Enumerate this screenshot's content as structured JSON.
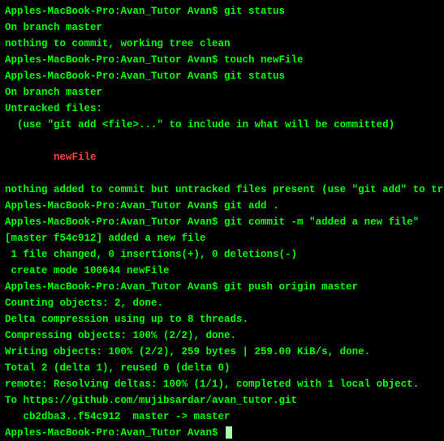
{
  "prompt": "Apples-MacBook-Pro:Avan_Tutor Avan$ ",
  "lines": {
    "l0_cmd": "git status",
    "l1": "On branch master",
    "l2": "nothing to commit, working tree clean",
    "l3_cmd": "touch newFile",
    "l4_cmd": "git status",
    "l5": "On branch master",
    "l6": "Untracked files:",
    "l7": "  (use \"git add <file>...\" to include in what will be committed)",
    "l8_untracked": "\tnewFile",
    "l9": "nothing added to commit but untracked files present (use \"git add\" to track)",
    "l10_cmd": "git add .",
    "l11_cmd": "git commit -m \"added a new file\"",
    "l12": "[master f54c912] added a new file",
    "l13": " 1 file changed, 0 insertions(+), 0 deletions(-)",
    "l14": " create mode 100644 newFile",
    "l15_cmd": "git push origin master",
    "l16": "Counting objects: 2, done.",
    "l17": "Delta compression using up to 8 threads.",
    "l18": "Compressing objects: 100% (2/2), done.",
    "l19": "Writing objects: 100% (2/2), 259 bytes | 259.00 KiB/s, done.",
    "l20": "Total 2 (delta 1), reused 0 (delta 0)",
    "l21": "remote: Resolving deltas: 100% (1/1), completed with 1 local object.",
    "l22": "To https://github.com/mujibsardar/avan_tutor.git",
    "l23": "   cb2dba3..f54c912  master -> master"
  }
}
